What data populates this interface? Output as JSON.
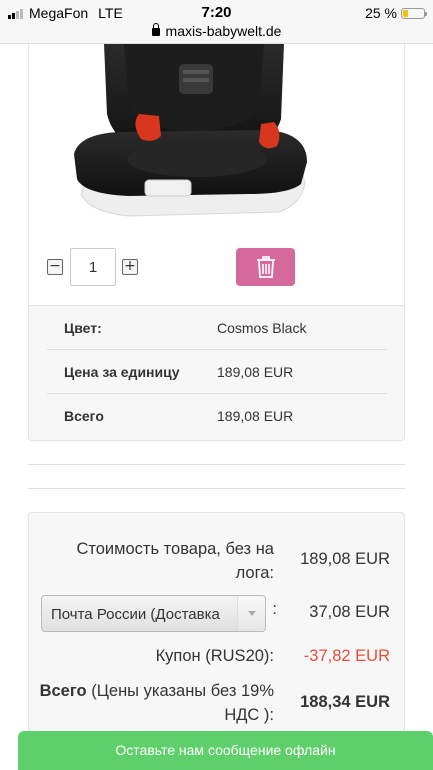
{
  "status_bar": {
    "carrier": "MegaFon",
    "network": "LTE",
    "time": "7:20",
    "battery": "25 %",
    "battery_level": 0.25,
    "url": "maxis-babywelt.de"
  },
  "product": {
    "image_icon": "car-seat-image",
    "quantity": "1",
    "minus_label": "−",
    "plus_label": "+",
    "delete_icon": "trash-icon",
    "attributes": [
      {
        "key": "Цвет:",
        "value": "Cosmos Black"
      },
      {
        "key": "Цена за единицу",
        "value": "189,08 EUR"
      },
      {
        "key": "Всего",
        "value": "189,08 EUR"
      }
    ]
  },
  "summary": {
    "subtotal_label": "Стоимость товара, без на лога:",
    "subtotal_value": "189,08 EUR",
    "shipping_select": "Почта России (Доставка",
    "shipping_colon": ":",
    "shipping_value": "37,08 EUR",
    "coupon_label": "Купон (RUS20):",
    "coupon_value": "-37,82 EUR",
    "total_label_bold": "Всего",
    "total_label_rest": " (Цены указаны без 19% НДС ):",
    "total_value": "188,34 EUR"
  },
  "chat": {
    "label": "Оставьте нам сообщение офлайн"
  },
  "colors": {
    "delete_button": "#d5699c",
    "coupon_red": "#e74c3c",
    "chat_green": "#5fcf6b"
  }
}
